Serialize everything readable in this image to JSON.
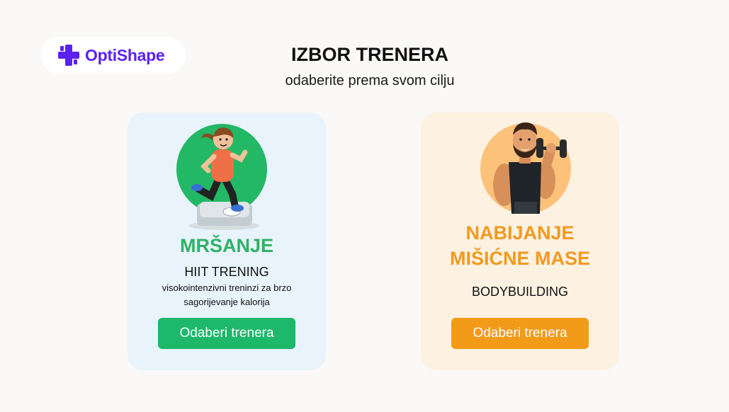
{
  "brand": {
    "name": "OptiShape",
    "icon": "plus-cross-icon",
    "color": "#5b21f3"
  },
  "header": {
    "title": "IZBOR TRENERA",
    "subtitle": "odaberite prema svom cilju"
  },
  "cards": [
    {
      "title": "MRŠANJE",
      "program": "HIIT TRENING",
      "description": "visokointenzivni treninzi za brzo sagorijevanje kalorija",
      "button_label": "Odaberi trenera",
      "illustration": "running-woman-on-scale-icon",
      "accent": "#2fb265",
      "background": "#e8f3fb"
    },
    {
      "title": "NABIJANJE MIŠIĆNE MASE",
      "program": "BODYBUILDING",
      "button_label": "Odaberi trenera",
      "illustration": "bodybuilder-with-dumbbell-icon",
      "accent": "#f09a1f",
      "background": "#fdf1e2"
    }
  ]
}
